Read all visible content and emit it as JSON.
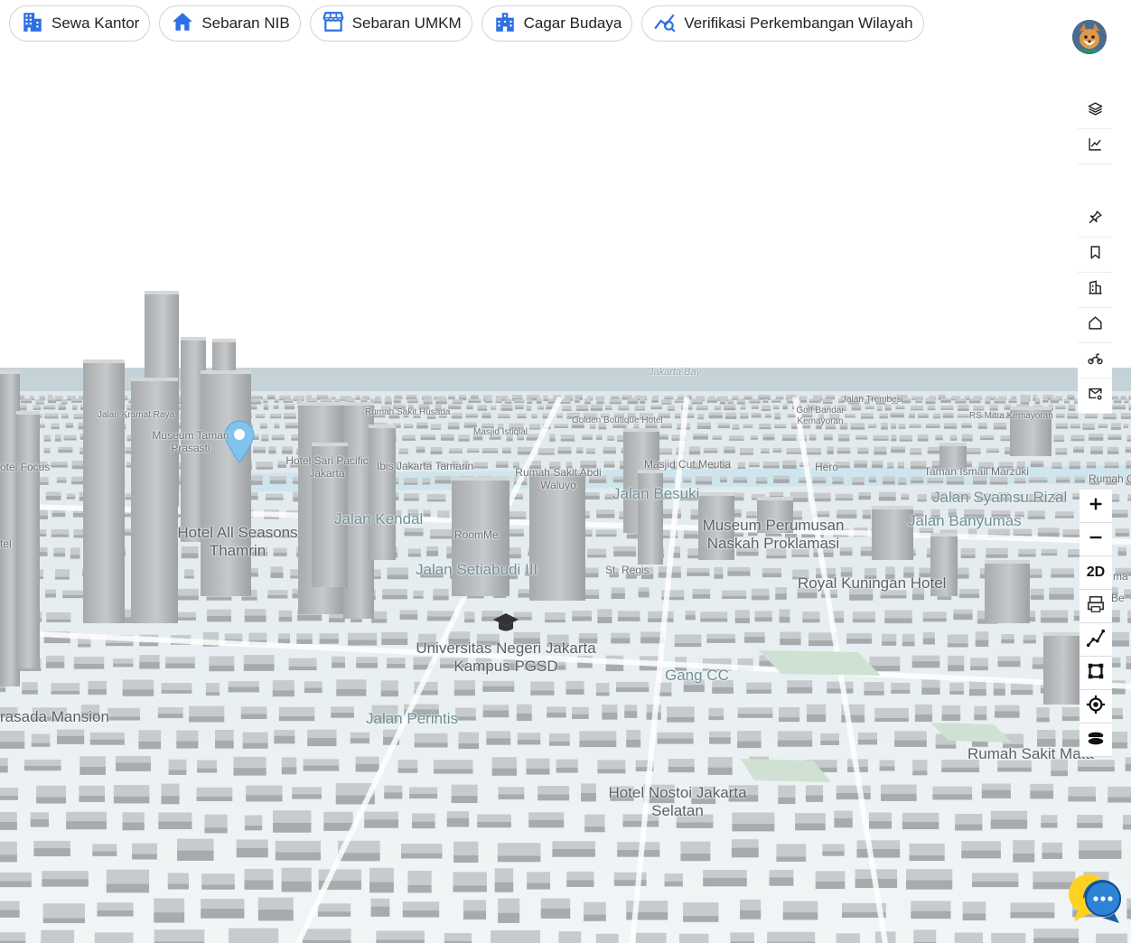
{
  "tabs": [
    {
      "label": "Sewa Kantor",
      "icon": "office-building-icon"
    },
    {
      "label": "Sebaran NIB",
      "icon": "home-icon"
    },
    {
      "label": "Sebaran UMKM",
      "icon": "storefront-icon"
    },
    {
      "label": "Cagar Budaya",
      "icon": "heritage-building-icon"
    },
    {
      "label": "Verifikasi Perkembangan Wilayah",
      "icon": "trend-search-icon"
    }
  ],
  "colors": {
    "accent": "#2f6fe4",
    "map_ground": "#eef3f5",
    "building": "#bfc2c5",
    "water": "#c9e4ec",
    "pin": "#7fc3ee"
  },
  "toolbar_icons": [
    "layers-icon",
    "chart-line-icon",
    "pin-icon",
    "bookmark-icon",
    "building-outline-icon",
    "house-icon",
    "motorbike-icon",
    "mail-settings-icon"
  ],
  "controls": {
    "mode_label": "2D",
    "icons": [
      "zoom-in-icon",
      "zoom-out-icon",
      "mode-2d-toggle",
      "print-icon",
      "measure-line-icon",
      "measure-area-icon",
      "locate-icon",
      "basemap-icon"
    ]
  },
  "map": {
    "bay": "Jakarta Bay",
    "big_labels": [
      "Hotel All Seasons Thamrin",
      "Universitas Negeri Jakarta Kampus PGSD",
      "Hotel Nostoi Jakarta Selatan",
      "Royal Kuningan Hotel",
      "Rumah Sakit Mata",
      "Museum Perumusan Naskah Proklamasi",
      "rasada Mansion"
    ],
    "road_labels": [
      "Jalan Kendal",
      "Jalan Setiabudi III",
      "Jalan Perintis",
      "Gang CC",
      "Jalan Besuki",
      "Jalan Syamsu Rizal",
      "Jalan Banyumas"
    ],
    "mid_labels": [
      "RoomMe",
      "St. Regis",
      "Rumah Sakit Abdi Waluyo",
      "Hotel Sari Pacific Jakarta",
      "Ibis Jakarta Tamarin",
      "Masjid Cut Meutia",
      "Hero",
      "Taman Ismail Marzuki",
      "Rumah C",
      "Museum Taman Prasasti",
      "otel Focus",
      "tel",
      "ma",
      "Be"
    ],
    "small_labels": [
      "Rumah Sakit Husada",
      "Masjid Istiqlal",
      "Golden Boutique Hotel",
      "Golf Bandar Kemayoran",
      "Jalan Trembesi",
      "RS Mitra Kemayoran",
      "Jalan Kramat Raya"
    ]
  }
}
